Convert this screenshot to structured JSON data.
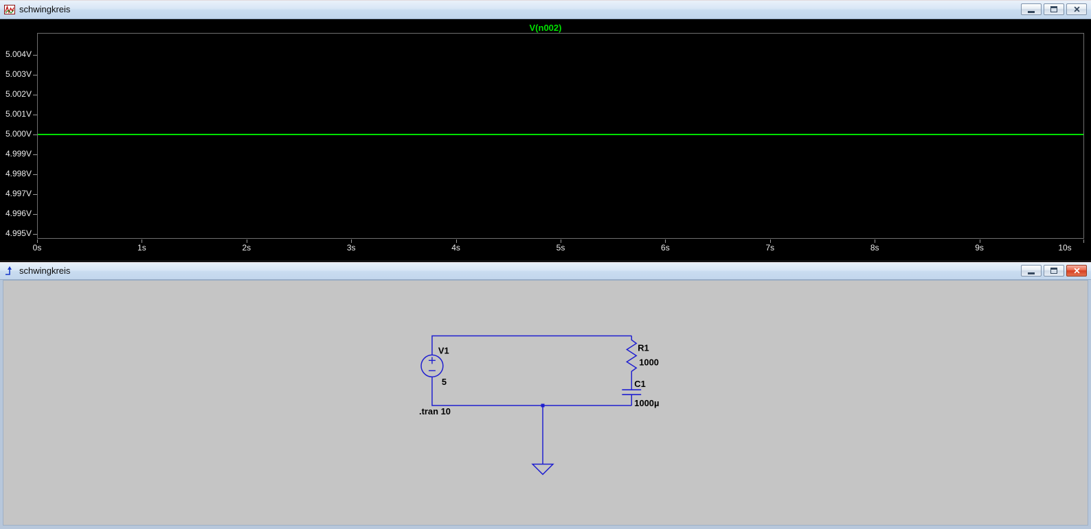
{
  "waveform_window": {
    "title": "schwingkreis",
    "controls": [
      "minimize",
      "maximize",
      "close"
    ]
  },
  "chart_data": {
    "type": "line",
    "title": "V(n002)",
    "x_ticks": [
      "0s",
      "1s",
      "2s",
      "3s",
      "4s",
      "5s",
      "6s",
      "7s",
      "8s",
      "9s",
      "10s"
    ],
    "y_ticks": [
      "5.004V",
      "5.003V",
      "5.002V",
      "5.001V",
      "5.000V",
      "4.999V",
      "4.998V",
      "4.997V",
      "4.996V",
      "4.995V"
    ],
    "xlim": [
      0,
      10
    ],
    "ylim": [
      4.995,
      5.004
    ],
    "x_unit": "s",
    "y_unit": "V",
    "grid": false,
    "background": "#000000",
    "legend_position": "top-center",
    "series": [
      {
        "name": "V(n002)",
        "color": "#00E000",
        "x": [
          0,
          10
        ],
        "y": [
          5.0,
          5.0
        ]
      }
    ]
  },
  "schematic_window": {
    "title": "schwingkreis",
    "directive": ".tran 10",
    "components": [
      {
        "ref": "V1",
        "value": "5",
        "type": "voltage-source"
      },
      {
        "ref": "R1",
        "value": "1000",
        "type": "resistor"
      },
      {
        "ref": "C1",
        "value": "1000µ",
        "type": "capacitor"
      }
    ],
    "controls": [
      "minimize",
      "maximize",
      "close"
    ],
    "colors": {
      "wire": "#1F1FD0",
      "background": "#C5C5C5",
      "label": "#000000"
    }
  }
}
